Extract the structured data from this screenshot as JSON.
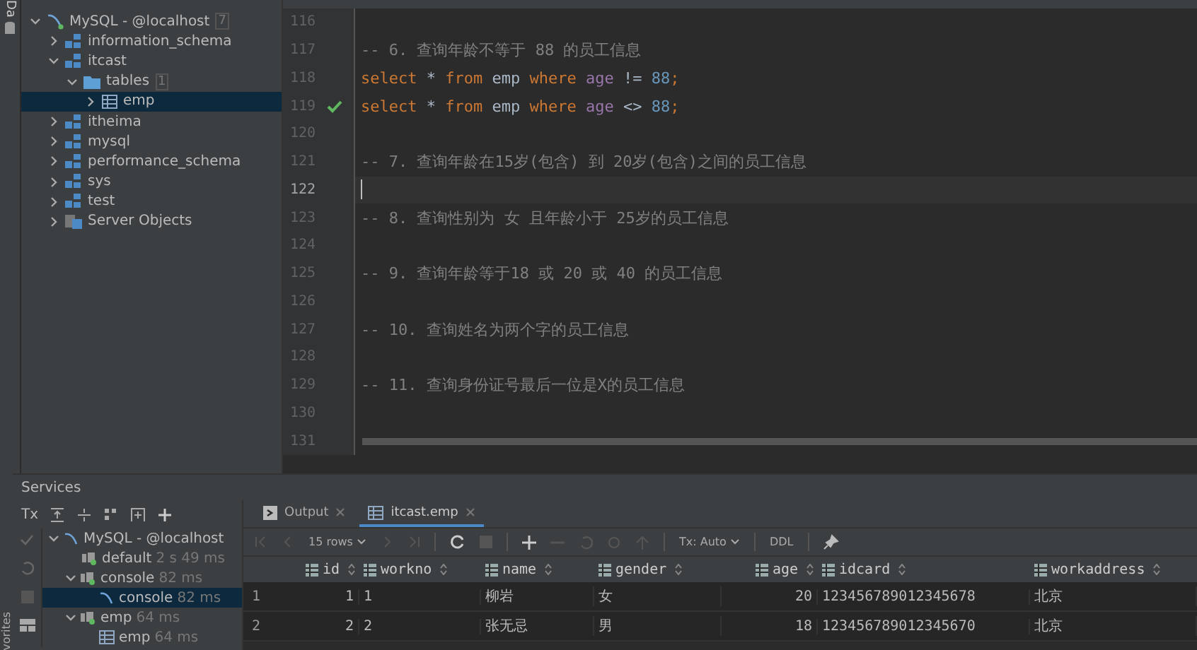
{
  "side_strip": {
    "top_label": "Da",
    "bottom_label": "vorites"
  },
  "db_tree": [
    {
      "label": "MySQL - @localhost",
      "kind": "connection",
      "count": "7",
      "expanded": true,
      "selected": false,
      "children": [
        {
          "label": "information_schema",
          "kind": "schema",
          "expanded": false,
          "selected": false
        },
        {
          "label": "itcast",
          "kind": "schema",
          "expanded": true,
          "selected": false,
          "children": [
            {
              "label": "tables",
              "kind": "folder",
              "count": "1",
              "expanded": true,
              "selected": false,
              "children": [
                {
                  "label": "emp",
                  "kind": "table",
                  "expanded": false,
                  "selected": true
                }
              ]
            }
          ]
        },
        {
          "label": "itheima",
          "kind": "schema",
          "expanded": false,
          "selected": false
        },
        {
          "label": "mysql",
          "kind": "schema",
          "expanded": false,
          "selected": false
        },
        {
          "label": "performance_schema",
          "kind": "schema",
          "expanded": false,
          "selected": false
        },
        {
          "label": "sys",
          "kind": "schema",
          "expanded": false,
          "selected": false
        },
        {
          "label": "test",
          "kind": "schema",
          "expanded": false,
          "selected": false
        },
        {
          "label": "Server Objects",
          "kind": "server",
          "expanded": false,
          "selected": false
        }
      ]
    }
  ],
  "editor": {
    "lines": [
      {
        "number": "116",
        "kind": "empty",
        "current": false,
        "executed": false
      },
      {
        "number": "117",
        "kind": "comment",
        "text": "-- 6. 查询年龄不等于 88 的员工信息",
        "current": false,
        "executed": false
      },
      {
        "number": "118",
        "kind": "code",
        "current": false,
        "executed": false,
        "tokens": [
          {
            "text": "select",
            "kind": "keyword"
          },
          {
            "text": " * ",
            "kind": "plain"
          },
          {
            "text": "from",
            "kind": "keyword"
          },
          {
            "text": " emp ",
            "kind": "plain"
          },
          {
            "text": "where",
            "kind": "keyword"
          },
          {
            "text": " age",
            "kind": "column"
          },
          {
            "text": " != ",
            "kind": "plain"
          },
          {
            "text": "88",
            "kind": "number"
          },
          {
            "text": ";",
            "kind": "keyword"
          }
        ]
      },
      {
        "number": "119",
        "kind": "code",
        "current": false,
        "executed": true,
        "tokens": [
          {
            "text": "select",
            "kind": "keyword"
          },
          {
            "text": " * ",
            "kind": "plain"
          },
          {
            "text": "from",
            "kind": "keyword"
          },
          {
            "text": " emp ",
            "kind": "plain"
          },
          {
            "text": "where",
            "kind": "keyword"
          },
          {
            "text": " age",
            "kind": "column"
          },
          {
            "text": " <> ",
            "kind": "plain"
          },
          {
            "text": "88",
            "kind": "number"
          },
          {
            "text": ";",
            "kind": "keyword"
          }
        ]
      },
      {
        "number": "120",
        "kind": "empty",
        "current": false,
        "executed": false
      },
      {
        "number": "121",
        "kind": "comment",
        "text": "-- 7. 查询年龄在15岁(包含) 到 20岁(包含)之间的员工信息",
        "current": false,
        "executed": false
      },
      {
        "number": "122",
        "kind": "empty",
        "current": true,
        "executed": false
      },
      {
        "number": "123",
        "kind": "comment",
        "text": "-- 8. 查询性别为 女 且年龄小于 25岁的员工信息",
        "current": false,
        "executed": false
      },
      {
        "number": "124",
        "kind": "empty",
        "current": false,
        "executed": false
      },
      {
        "number": "125",
        "kind": "comment",
        "text": "-- 9. 查询年龄等于18 或 20 或 40 的员工信息",
        "current": false,
        "executed": false
      },
      {
        "number": "126",
        "kind": "empty",
        "current": false,
        "executed": false
      },
      {
        "number": "127",
        "kind": "comment",
        "text": "-- 10. 查询姓名为两个字的员工信息",
        "current": false,
        "executed": false
      },
      {
        "number": "128",
        "kind": "empty",
        "current": false,
        "executed": false
      },
      {
        "number": "129",
        "kind": "comment",
        "text": "-- 11. 查询身份证号最后一位是X的员工信息",
        "current": false,
        "executed": false
      },
      {
        "number": "130",
        "kind": "empty",
        "current": false,
        "executed": false
      },
      {
        "number": "131",
        "kind": "empty",
        "current": false,
        "executed": false
      }
    ]
  },
  "services": {
    "title": "Services",
    "tx_label": "Tx",
    "tree": [
      {
        "label": "MySQL - @localhost",
        "kind": "connection",
        "expanded": true,
        "selected": false,
        "children": [
          {
            "label": "default",
            "time": "2 s 49 ms",
            "kind": "session",
            "selected": false
          },
          {
            "label": "console",
            "time": "82 ms",
            "kind": "session",
            "expanded": true,
            "selected": false,
            "children": [
              {
                "label": "console",
                "time": "82 ms",
                "kind": "console",
                "selected": true
              }
            ]
          },
          {
            "label": "emp",
            "time": "64 ms",
            "kind": "session",
            "expanded": true,
            "selected": false,
            "children": [
              {
                "label": "emp",
                "time": "64 ms",
                "kind": "table",
                "selected": false
              }
            ]
          }
        ]
      }
    ],
    "tabs": [
      {
        "label": "Output",
        "kind": "output",
        "selected": false
      },
      {
        "label": "itcast.emp",
        "kind": "table",
        "selected": true
      }
    ],
    "toolbar": {
      "rows": "15 rows",
      "tx": "Tx: Auto",
      "ddl": "DDL"
    },
    "table": {
      "columns": [
        {
          "name": "id",
          "kind": "number"
        },
        {
          "name": "workno",
          "kind": "text"
        },
        {
          "name": "name",
          "kind": "text"
        },
        {
          "name": "gender",
          "kind": "text"
        },
        {
          "name": "age",
          "kind": "number"
        },
        {
          "name": "idcard",
          "kind": "text"
        },
        {
          "name": "workaddress",
          "kind": "text"
        }
      ],
      "rows": [
        {
          "number": "1",
          "cells": [
            "1",
            "1",
            "柳岩",
            "女",
            "20",
            "123456789012345678",
            "北京"
          ]
        },
        {
          "number": "2",
          "cells": [
            "2",
            "2",
            "张无忌",
            "男",
            "18",
            "123456789012345670",
            "北京"
          ]
        }
      ]
    }
  }
}
